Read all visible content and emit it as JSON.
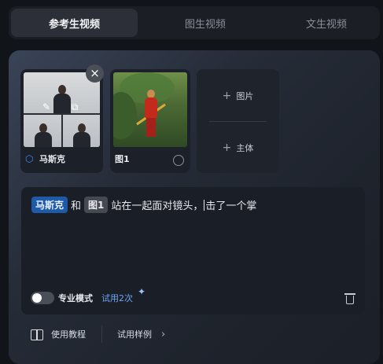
{
  "tabs": [
    {
      "label": "参考生视频",
      "active": true
    },
    {
      "label": "图生视频",
      "active": false
    },
    {
      "label": "文生视频",
      "active": false
    }
  ],
  "references": [
    {
      "label": "马斯克",
      "icon": "cube-icon"
    },
    {
      "label": "图1",
      "icon": "refresh-icon"
    }
  ],
  "add_options": {
    "image_label": "图片",
    "subject_label": "主体"
  },
  "prompt": {
    "chip_subject": "马斯克",
    "connector": "和",
    "chip_image": "图1",
    "text_before_caret": "站在一起面对镜头，",
    "text_after_caret": "击了一个掌"
  },
  "mode": {
    "label": "专业模式",
    "trial_text": "试用2次",
    "enabled": false
  },
  "footer": {
    "tutorial_label": "使用教程",
    "samples_label": "试用样例"
  },
  "colors": {
    "accent_blue": "#1f5aa8",
    "link_blue": "#6aa6f5"
  }
}
